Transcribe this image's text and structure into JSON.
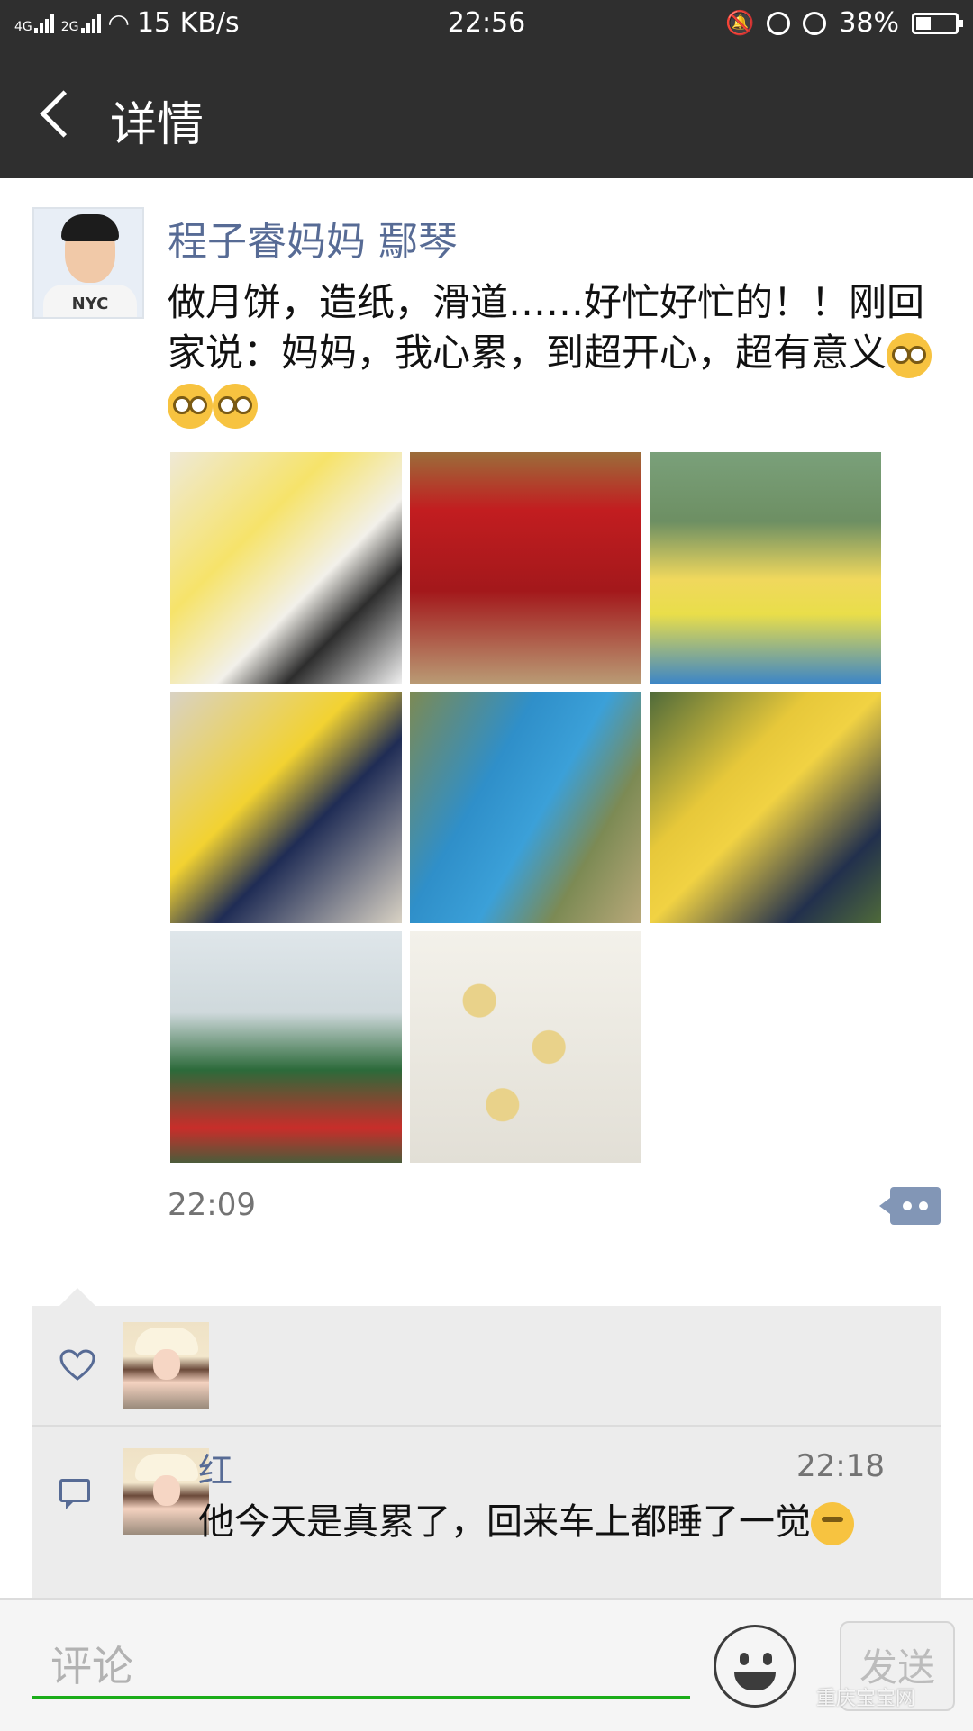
{
  "status_bar": {
    "net1": "4G",
    "net2": "2G",
    "speed": "15 KB/s",
    "time": "22:56",
    "battery": "38%",
    "battery_level": 0.38
  },
  "nav": {
    "title": "详情"
  },
  "post": {
    "poster_name": "程子睿妈妈 鄢琴",
    "avatar_shirt_text": "NYC",
    "text_line1": "做月饼，造纸，滑道……好忙好忙的！！刚回",
    "text_line2": "家说：妈妈，我心累，到超开心，超有意义",
    "time": "22:09"
  },
  "comment": {
    "name": "红",
    "time": "22:18",
    "text": "他今天是真累了，回来车上都睡了一觉"
  },
  "input_bar": {
    "placeholder": "评论",
    "send_label": "发送"
  },
  "watermark": "重庆宝宝网",
  "colors": {
    "bar_bg": "#2f2f2f",
    "link_blue": "#576b95",
    "green_underline": "#1aad19"
  }
}
